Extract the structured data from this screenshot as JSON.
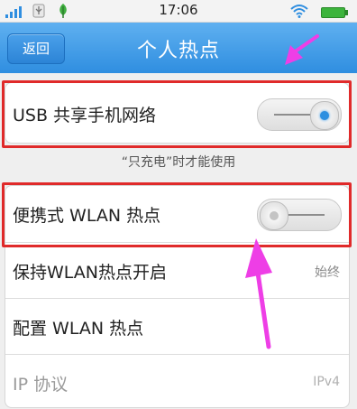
{
  "status_bar": {
    "time": "17:06",
    "icons": [
      "signal-icon",
      "usb-icon",
      "leaf-icon",
      "wifi-icon",
      "battery-icon"
    ]
  },
  "header": {
    "back_label": "返回",
    "title": "个人热点"
  },
  "settings": {
    "usb_tethering": {
      "label": "USB 共享手机网络",
      "state": "on"
    },
    "hint": "“只充电”时才能使用",
    "items": [
      {
        "label": "便携式 WLAN 热点",
        "control": "toggle",
        "state": "off"
      },
      {
        "label": "保持WLAN热点开启",
        "value": "始终"
      },
      {
        "label": "配置 WLAN 热点"
      },
      {
        "label": "IP 协议",
        "value": "IPv4",
        "disabled": true
      }
    ]
  },
  "colors": {
    "accent": "#2f8ee0",
    "highlight_box": "#e02a2a",
    "annotation_arrow": "#ee3ee6"
  }
}
